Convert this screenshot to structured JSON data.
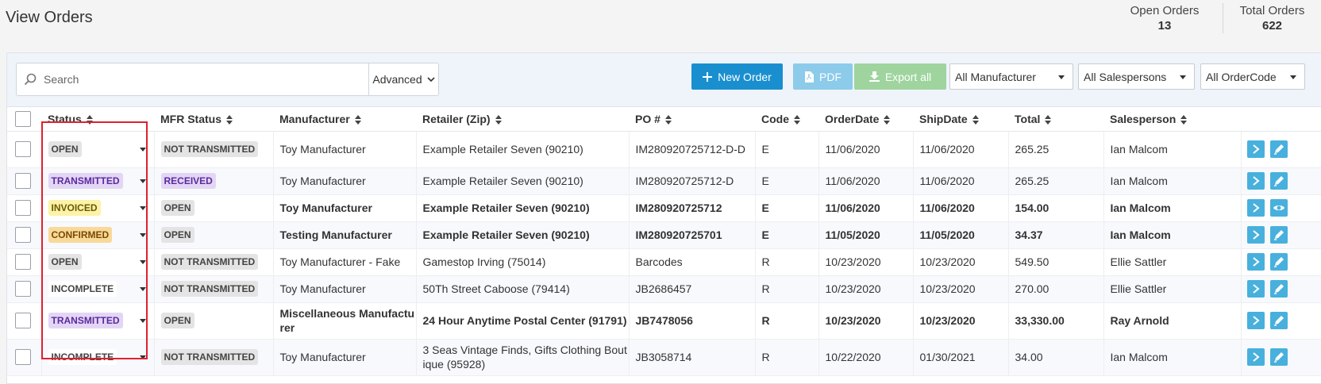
{
  "page": {
    "title": "View Orders"
  },
  "stats": {
    "open_label": "Open Orders",
    "open_value": "13",
    "total_label": "Total Orders",
    "total_value": "622"
  },
  "toolbar": {
    "search_placeholder": "Search",
    "advanced_label": "Advanced",
    "new_order_label": "New Order",
    "pdf_label": "PDF",
    "export_label": "Export all",
    "manufacturer_select": "All Manufacturer",
    "salesperson_select": "All Salespersons",
    "ordercode_select": "All OrderCode"
  },
  "columns": [
    "Status",
    "MFR Status",
    "Manufacturer",
    "Retailer (Zip)",
    "PO #",
    "Code",
    "OrderDate",
    "ShipDate",
    "Total",
    "Salesperson"
  ],
  "rows": [
    {
      "status": "OPEN",
      "status_style": "open",
      "mfr_status": "NOT TRANSMITTED",
      "mfr_style": "not",
      "manufacturer": "Toy Manufacturer",
      "retailer": "Example Retailer Seven (90210)",
      "po": "IM280920725712-D-D",
      "code": "E",
      "order_date": "11/06/2020",
      "ship_date": "11/06/2020",
      "total": "265.25",
      "salesperson": "Ian Malcom",
      "bold": false,
      "action": "edit"
    },
    {
      "status": "TRANSMITTED",
      "status_style": "trans",
      "mfr_status": "RECEIVED",
      "mfr_style": "rec",
      "manufacturer": "Toy Manufacturer",
      "retailer": "Example Retailer Seven (90210)",
      "po": "IM280920725712-D",
      "code": "E",
      "order_date": "11/06/2020",
      "ship_date": "11/06/2020",
      "total": "265.25",
      "salesperson": "Ian Malcom",
      "bold": false,
      "action": "edit"
    },
    {
      "status": "INVOICED",
      "status_style": "inv",
      "mfr_status": "OPEN",
      "mfr_style": "not",
      "manufacturer": "Toy Manufacturer",
      "retailer": "Example Retailer Seven (90210)",
      "po": "IM280920725712",
      "code": "E",
      "order_date": "11/06/2020",
      "ship_date": "11/06/2020",
      "total": "154.00",
      "salesperson": "Ian Malcom",
      "bold": true,
      "action": "view"
    },
    {
      "status": "CONFIRMED",
      "status_style": "conf",
      "mfr_status": "OPEN",
      "mfr_style": "not",
      "manufacturer": "Testing Manufacturer",
      "retailer": "Example Retailer Seven (90210)",
      "po": "IM280920725701",
      "code": "E",
      "order_date": "11/05/2020",
      "ship_date": "11/05/2020",
      "total": "34.37",
      "salesperson": "Ian Malcom",
      "bold": true,
      "action": "edit"
    },
    {
      "status": "OPEN",
      "status_style": "open",
      "mfr_status": "NOT TRANSMITTED",
      "mfr_style": "not",
      "manufacturer": "Toy Manufacturer - Fake",
      "retailer": "Gamestop Irving (75014)",
      "po": "Barcodes",
      "code": "R",
      "order_date": "10/23/2020",
      "ship_date": "10/23/2020",
      "total": "549.50",
      "salesperson": "Ellie Sattler",
      "bold": false,
      "action": "edit"
    },
    {
      "status": "INCOMPLETE",
      "status_style": "inc",
      "mfr_status": "NOT TRANSMITTED",
      "mfr_style": "not",
      "manufacturer": "Toy Manufacturer",
      "retailer": "50Th Street Caboose (79414)",
      "po": "JB2686457",
      "code": "R",
      "order_date": "10/23/2020",
      "ship_date": "10/23/2020",
      "total": "270.00",
      "salesperson": "Ellie Sattler",
      "bold": false,
      "action": "edit"
    },
    {
      "status": "TRANSMITTED",
      "status_style": "trans",
      "mfr_status": "OPEN",
      "mfr_style": "not",
      "manufacturer": "Miscellaneous Manufacturer",
      "retailer": "24 Hour Anytime Postal Center (91791)",
      "po": "JB7478056",
      "code": "R",
      "order_date": "10/23/2020",
      "ship_date": "10/23/2020",
      "total": "33,330.00",
      "salesperson": "Ray Arnold",
      "bold": true,
      "action": "edit"
    },
    {
      "status": "INCOMPLETE",
      "status_style": "inc",
      "mfr_status": "NOT TRANSMITTED",
      "mfr_style": "not",
      "manufacturer": "Toy Manufacturer",
      "retailer": "3 Seas Vintage Finds, Gifts Clothing Boutique (95928)",
      "po": "JB3058714",
      "code": "R",
      "order_date": "10/22/2020",
      "ship_date": "01/30/2021",
      "total": "34.00",
      "salesperson": "Ian Malcom",
      "bold": false,
      "action": "edit"
    }
  ],
  "colors": {
    "primary": "#1a8fcf",
    "action": "#48b0dd",
    "highlight": "#e02030"
  }
}
